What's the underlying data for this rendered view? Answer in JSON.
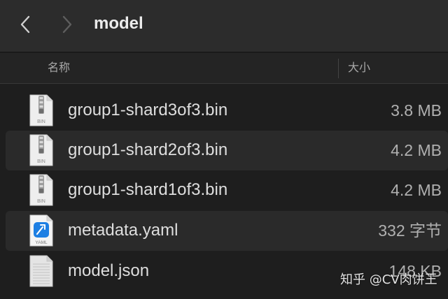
{
  "toolbar": {
    "title": "model",
    "back_icon": "chevron-left-icon",
    "forward_icon": "chevron-right-icon"
  },
  "columns": {
    "name_label": "名称",
    "size_label": "大小"
  },
  "files": [
    {
      "name": "group1-shard3of3.bin",
      "size": "3.8 MB",
      "icon": "bin-file-icon",
      "icon_label": "BIN"
    },
    {
      "name": "group1-shard2of3.bin",
      "size": "4.2 MB",
      "icon": "bin-file-icon",
      "icon_label": "BIN"
    },
    {
      "name": "group1-shard1of3.bin",
      "size": "4.2 MB",
      "icon": "bin-file-icon",
      "icon_label": "BIN"
    },
    {
      "name": "metadata.yaml",
      "size": "332 字节",
      "icon": "yaml-file-icon",
      "icon_label": "YAML"
    },
    {
      "name": "model.json",
      "size": "148 KB",
      "icon": "json-file-icon",
      "icon_label": ""
    }
  ],
  "watermark": "知乎 @CV肉饼王",
  "colors": {
    "background": "#1e1e1e",
    "toolbar": "#2c2c2c",
    "row_alternate": "#2a2a2a",
    "text": "#dedede",
    "secondary_text": "#a8a8a8",
    "yaml_accent": "#1d7fe3"
  }
}
